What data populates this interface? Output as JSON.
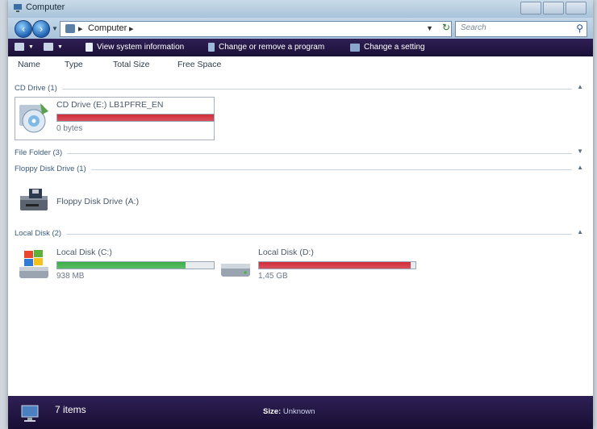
{
  "window": {
    "title": "Computer"
  },
  "navigation": {
    "address": "Computer",
    "search_placeholder": "Search"
  },
  "toolbar": {
    "items": [
      {
        "label": "View system information"
      },
      {
        "label": "Change or remove a program"
      },
      {
        "label": "Change a setting"
      }
    ]
  },
  "columns": [
    "Name",
    "Type",
    "Total Size",
    "Free Space"
  ],
  "groups": {
    "cd": {
      "header": "CD Drive (1)",
      "drive": {
        "name": "CD Drive (E:) LB1PFRE_EN",
        "size": "0 bytes",
        "used_fraction": 1.0,
        "bar_color": "#d22b38"
      }
    },
    "folder": {
      "header": "File Folder (3)"
    },
    "floppy": {
      "header": "Floppy Disk Drive (1)",
      "drive": {
        "name": "Floppy Disk Drive (A:)"
      }
    },
    "local": {
      "header": "Local Disk (2)",
      "drives": [
        {
          "name": "Local Disk (C:)",
          "size": "938 MB",
          "used_fraction": 0.82,
          "bar_color": "#3aae45"
        },
        {
          "name": "Local Disk (D:)",
          "size": "1,45 GB",
          "used_fraction": 0.97,
          "bar_color": "#d22b38"
        }
      ]
    }
  },
  "status": {
    "items": "7 items",
    "size_label": "Size:",
    "size_value": "Unknown"
  },
  "colors": {
    "toolbar": "#2f1f55",
    "accent_red": "#d22b38",
    "accent_green": "#3aae45"
  }
}
